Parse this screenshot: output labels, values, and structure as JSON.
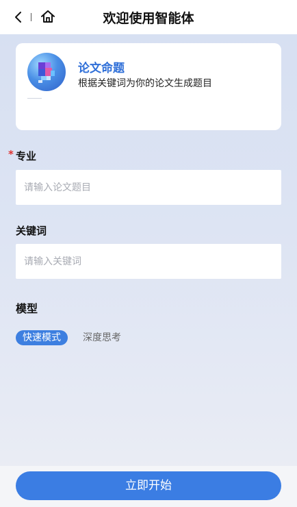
{
  "header": {
    "title": "欢迎使用智能体",
    "back_icon": "chevron-left-icon",
    "home_icon": "home-icon"
  },
  "agent": {
    "name": "论文命题",
    "description": "根据关键词为你的论文生成题目"
  },
  "form": {
    "major": {
      "required_mark": "*",
      "label": "专业",
      "placeholder": "请输入论文题目",
      "value": ""
    },
    "keywords": {
      "label": "关键词",
      "placeholder": "请输入关键词",
      "value": ""
    },
    "model": {
      "label": "模型",
      "options": [
        "快速模式",
        "深度思考"
      ],
      "selected": "快速模式"
    }
  },
  "actions": {
    "start_label": "立即开始"
  },
  "colors": {
    "accent": "#3b7de3",
    "required": "#e0312f",
    "agent_name": "#2f6fd8"
  }
}
